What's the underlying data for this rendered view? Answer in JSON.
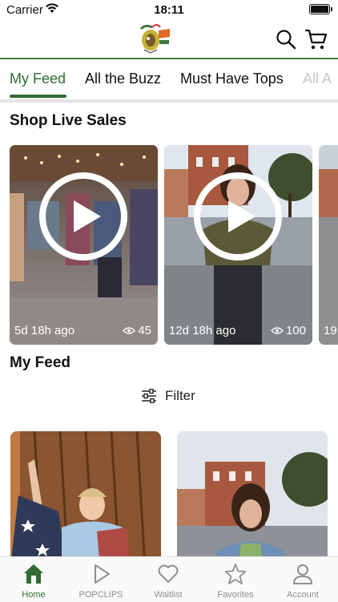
{
  "status_bar": {
    "carrier": "Carrier",
    "time": "18:11"
  },
  "header": {
    "logo": "Buzzi boutique logo",
    "icons": [
      "search-icon",
      "cart-icon"
    ]
  },
  "tabs": [
    {
      "label": "My Feed",
      "active": true
    },
    {
      "label": "All the Buzz",
      "active": false
    },
    {
      "label": "Must Have Tops",
      "active": false
    },
    {
      "label": "All A",
      "active": false
    }
  ],
  "live_sales": {
    "title": "Shop Live Sales",
    "items": [
      {
        "ago": "5d 18h ago",
        "views": "45"
      },
      {
        "ago": "12d 18h ago",
        "views": "100"
      },
      {
        "ago": "19",
        "views": ""
      }
    ]
  },
  "feed": {
    "title": "My Feed",
    "filter_label": "Filter"
  },
  "bottom_nav": [
    {
      "label": "Home",
      "icon": "home-icon",
      "active": true
    },
    {
      "label": "POPCLIPS",
      "icon": "play-icon",
      "active": false
    },
    {
      "label": "Waitlist",
      "icon": "heart-icon",
      "active": false
    },
    {
      "label": "Favorites",
      "icon": "star-icon",
      "active": false
    },
    {
      "label": "Account",
      "icon": "person-icon",
      "active": false
    }
  ],
  "colors": {
    "accent": "#2f6b32",
    "divider": "#e5e5e5",
    "inactive": "#8e8e93"
  }
}
